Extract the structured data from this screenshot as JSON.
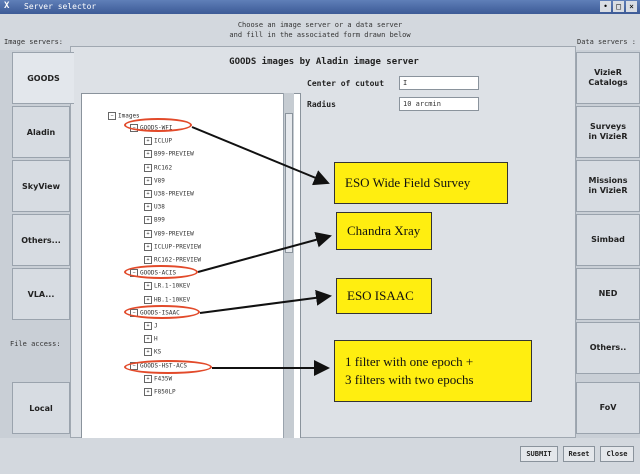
{
  "window": {
    "title": "Server selector",
    "app_logo": "X"
  },
  "header": {
    "instruction_line1": "Choose an image server or a data server",
    "instruction_line2": "and fill in the associated form drawn below",
    "image_servers_label": "Image servers:",
    "data_servers_label": "Data servers :"
  },
  "left_tabs": [
    {
      "label": "GOODS",
      "active": true
    },
    {
      "label": "Aladin"
    },
    {
      "label": "SkyView"
    },
    {
      "label": "Others..."
    },
    {
      "label": "VLA..."
    },
    {
      "label": "Local"
    }
  ],
  "file_access_label": "File access:",
  "right_tabs": [
    {
      "line1": "VizieR",
      "line2": "Catalogs"
    },
    {
      "line1": "Surveys",
      "line2": "in VizieR"
    },
    {
      "line1": "Missions",
      "line2": "in VizieR"
    },
    {
      "line1": "Simbad",
      "line2": ""
    },
    {
      "line1": "NED",
      "line2": ""
    },
    {
      "line1": "Others..",
      "line2": ""
    },
    {
      "line1": "FoV",
      "line2": ""
    }
  ],
  "panel": {
    "title": "GOODS images by Aladin image server",
    "center_label": "Center of cutout",
    "center_value": "I",
    "radius_label": "Radius",
    "radius_value": "10 arcmin"
  },
  "tree": {
    "root": "Images",
    "items": [
      "GOODS-WFI",
      "ICLUP",
      "B99-PREVIEW",
      "RC162",
      "V89",
      "U38-PREVIEW",
      "U38",
      "B99",
      "V89-PREVIEW",
      "ICLUP-PREVIEW",
      "RC162-PREVIEW",
      "GOODS-ACIS",
      "LR.1-10KEV",
      "HB.1-10KEV",
      "GOODS-ISAAC",
      "J",
      "H",
      "KS",
      "GOODS-HST-ACS",
      "F435W",
      "F850LP"
    ]
  },
  "annotations": [
    "ESO Wide Field Survey",
    "Chandra Xray",
    "ESO ISAAC",
    "1 filter with one epoch +",
    "3 filters with two epochs"
  ],
  "buttons": {
    "submit": "SUBMIT",
    "reset": "Reset",
    "close": "Close"
  },
  "colors": {
    "annotation_bg": "#ffee10",
    "highlight_ellipse": "#e24a2a"
  }
}
